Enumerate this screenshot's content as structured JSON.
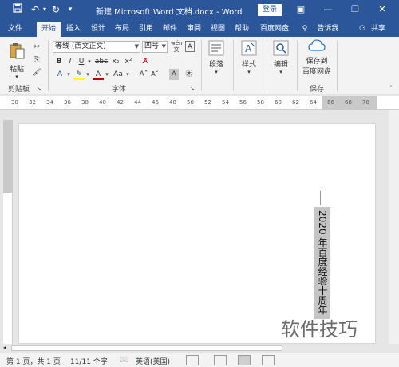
{
  "titlebar": {
    "title": "新建 Microsoft Word 文档.docx  -  Word",
    "login": "登录",
    "save_icon": "save-icon",
    "undo_icon": "undo-icon",
    "redo_icon": "redo-icon"
  },
  "tabs": [
    "文件",
    "开始",
    "插入",
    "设计",
    "布局",
    "引用",
    "邮件",
    "审阅",
    "视图",
    "帮助",
    "百度网盘"
  ],
  "tell_me": "告诉我",
  "share": "共享",
  "ribbon": {
    "clipboard": {
      "paste": "粘贴",
      "group": "剪贴板"
    },
    "font": {
      "font_name": "等线 (西文正文)",
      "font_size": "四号",
      "group": "字体",
      "bold": "B",
      "italic": "I",
      "underline": "U",
      "strike": "abc",
      "subscript": "x₂",
      "superscript": "x²",
      "wen": "文",
      "aa": "Aa",
      "grow": "A",
      "shrink": "A"
    },
    "paragraph": {
      "label": "段落"
    },
    "styles": {
      "label": "样式"
    },
    "editing": {
      "label": "编辑"
    },
    "save": {
      "label1": "保存到",
      "label2": "百度网盘",
      "group": "保存"
    }
  },
  "ruler_numbers": [
    "30",
    "32",
    "34",
    "36",
    "38",
    "40",
    "42",
    "44",
    "46",
    "48",
    "50",
    "52",
    "54",
    "56",
    "58",
    "60",
    "62",
    "64",
    "66",
    "68",
    "70",
    "72"
  ],
  "document": {
    "vertical_text": "2020 年百度经验十周年"
  },
  "watermark": "软件技巧",
  "status": {
    "page": "第 1 页，共 1 页",
    "words": "11/11 个字",
    "language": "英语(美国)"
  },
  "colors": {
    "accent": "#2b579a",
    "highlight": "#ffff00",
    "font_color": "#c00000"
  }
}
